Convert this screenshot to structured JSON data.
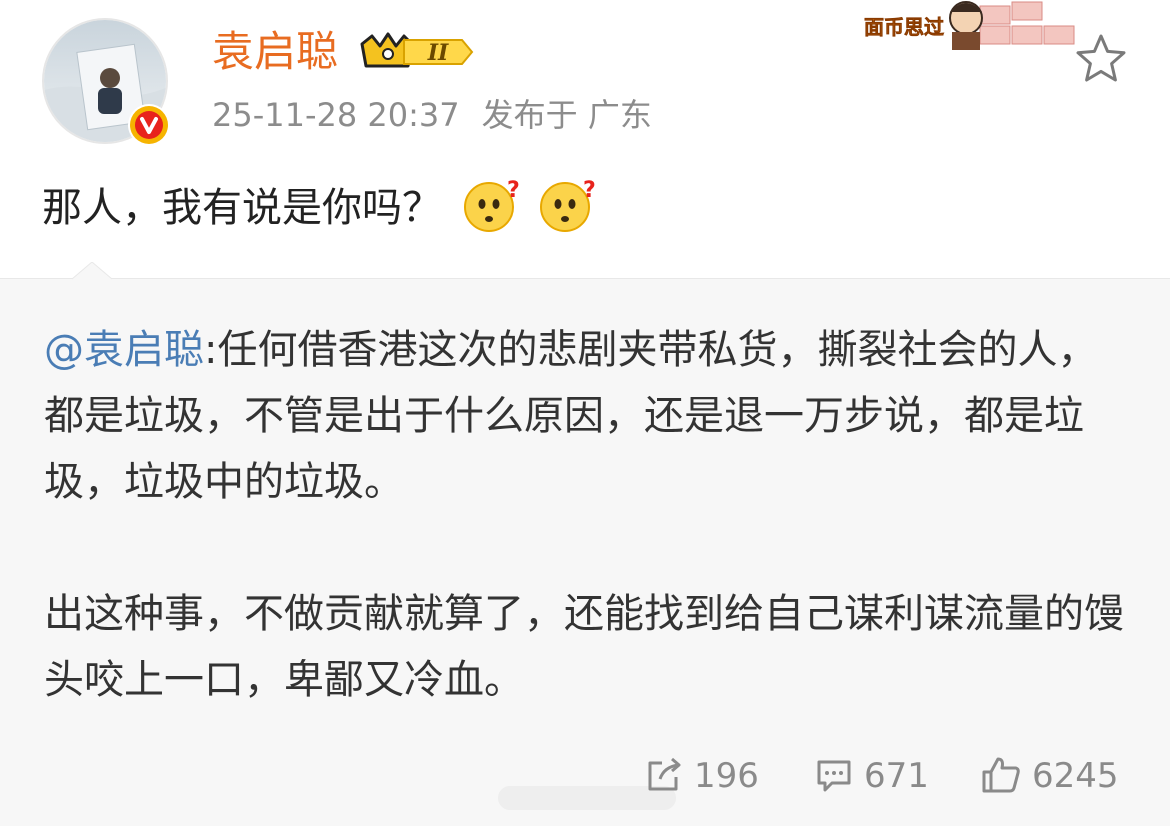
{
  "post": {
    "author": "袁启聪",
    "vip_level": "II",
    "timestamp": "25-11-28 20:37",
    "location": "发布于 广东",
    "text": "那人，我有说是你吗？",
    "emojis": [
      "thinking-question-emoji",
      "thinking-question-emoji"
    ]
  },
  "repost": {
    "mention": "@袁启聪",
    "text": ":任何借香港这次的悲剧夹带私货，撕裂社会的人，都是垃圾，不管是出于什么原因，还是退一万步说，都是垃圾，垃圾中的垃圾。\n\n出这种事，不做贡献就算了，还能找到给自己谋利谋流量的馒头咬上一口，卑鄙又冷血。"
  },
  "decoration": {
    "text": "面币思过"
  },
  "actions": {
    "reposts": "196",
    "comments": "671",
    "likes": "6245"
  },
  "colors": {
    "username": "#e86c21",
    "mention": "#4a7db5",
    "meta": "#8c8c8c",
    "repost_bg": "#f7f7f7"
  },
  "icons": [
    "avatar",
    "verified-badge-icon",
    "vip-crown-icon",
    "star-icon",
    "repost-icon",
    "comment-icon",
    "like-icon"
  ]
}
